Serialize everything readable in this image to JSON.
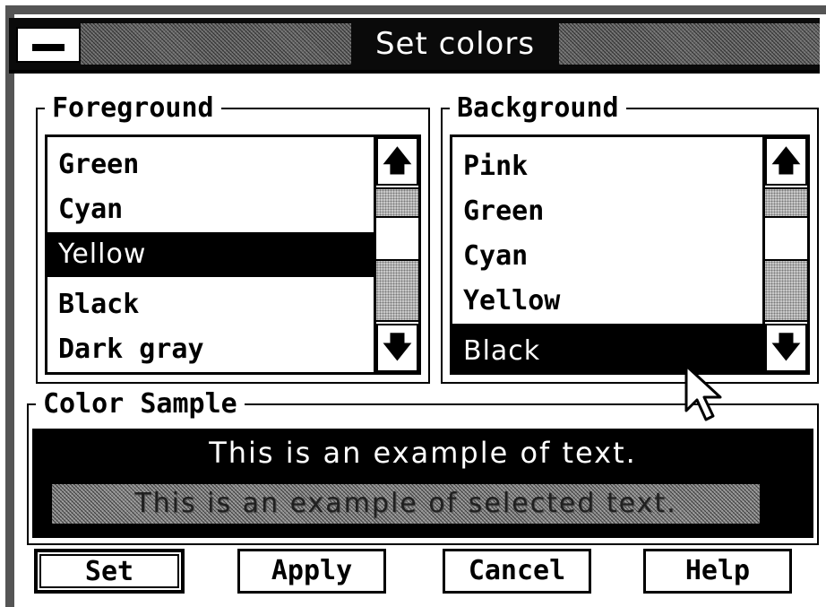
{
  "window": {
    "title": "Set colors"
  },
  "foreground": {
    "label": "Foreground",
    "items": [
      "Green",
      "Cyan",
      "Yellow",
      "Black",
      "Dark gray"
    ],
    "selected_index": 2
  },
  "background": {
    "label": "Background",
    "items": [
      "Pink",
      "Green",
      "Cyan",
      "Yellow",
      "Black"
    ],
    "selected_index": 4
  },
  "sample": {
    "label": "Color Sample",
    "text": "This is an example of text.",
    "selected_text": "This is an example of selected text."
  },
  "buttons": {
    "set": "Set",
    "apply": "Apply",
    "cancel": "Cancel",
    "help": "Help"
  },
  "icons": {
    "system_menu": "system-menu-icon",
    "scroll_up": "up-arrow-icon",
    "scroll_down": "down-arrow-icon",
    "cursor": "mouse-pointer-icon"
  }
}
